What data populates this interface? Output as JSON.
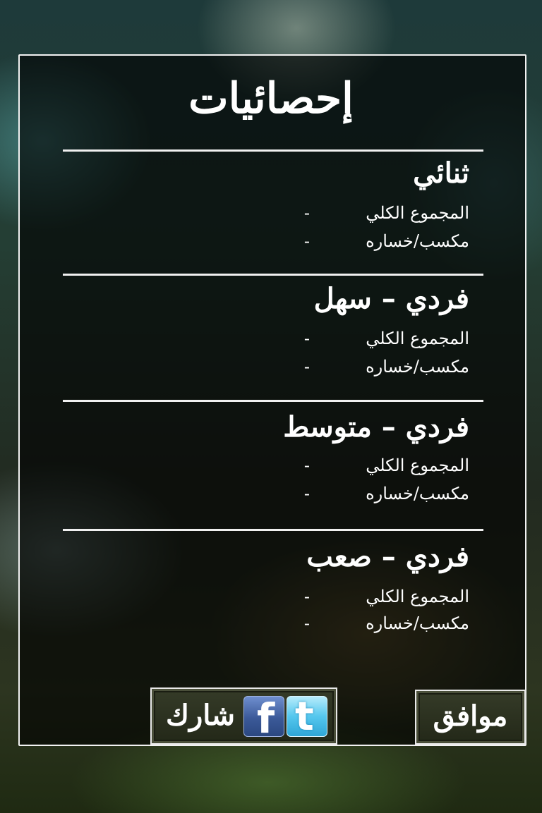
{
  "dialog": {
    "title": "إحصائيات"
  },
  "sections": [
    {
      "title": "ثنائي",
      "rows": [
        {
          "label": "المجموع الكلي",
          "value": "-"
        },
        {
          "label": "مكسب/خساره",
          "value": "-"
        }
      ]
    },
    {
      "title": "فردي – سهل",
      "rows": [
        {
          "label": "المجموع الكلي",
          "value": "-"
        },
        {
          "label": "مكسب/خساره",
          "value": "-"
        }
      ]
    },
    {
      "title": "فردي – متوسط",
      "rows": [
        {
          "label": "المجموع الكلي",
          "value": "-"
        },
        {
          "label": "مكسب/خساره",
          "value": "-"
        }
      ]
    },
    {
      "title": "فردي – صعب",
      "rows": [
        {
          "label": "المجموع الكلي",
          "value": "-"
        },
        {
          "label": "مكسب/خساره",
          "value": "-"
        }
      ]
    }
  ],
  "buttons": {
    "share_label": "شارك",
    "ok_label": "موافق",
    "facebook_icon": "facebook-icon",
    "twitter_icon": "twitter-icon",
    "facebook_glyph": "f",
    "twitter_glyph": "t"
  }
}
